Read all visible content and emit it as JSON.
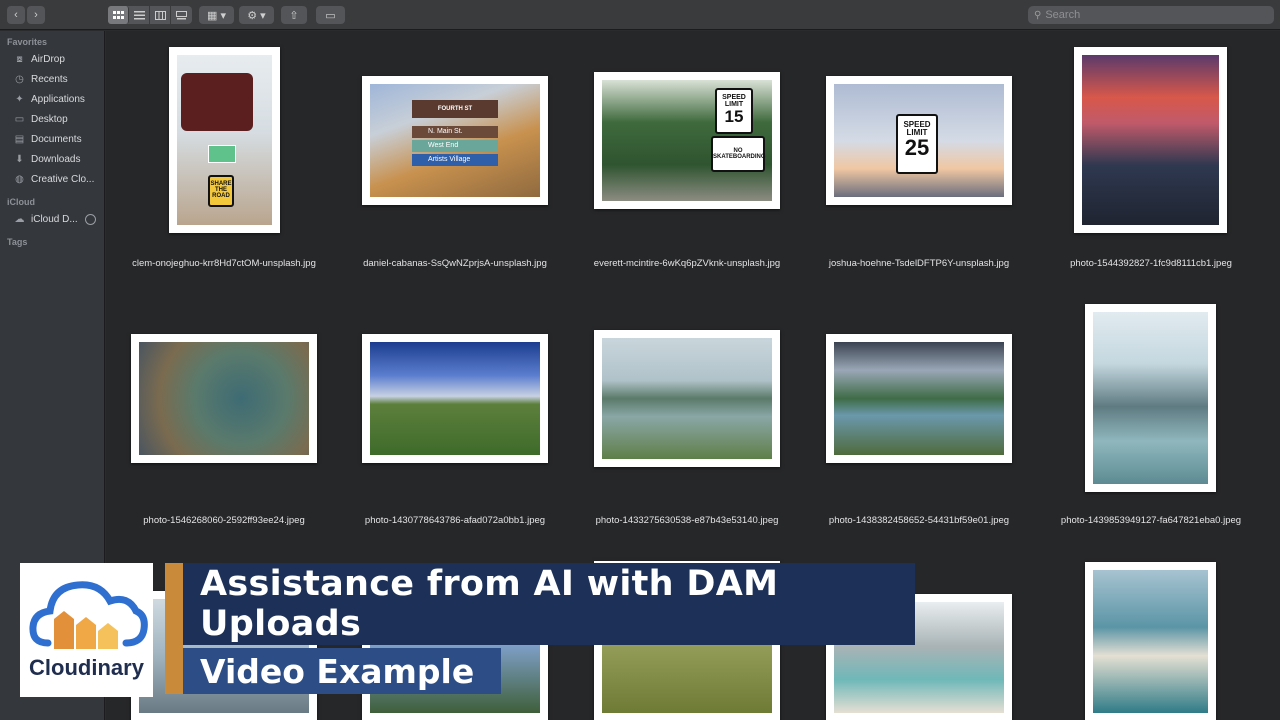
{
  "search": {
    "placeholder": "Search"
  },
  "sidebar": {
    "favorites_header": "Favorites",
    "icloud_header": "iCloud",
    "tags_header": "Tags",
    "favorites": [
      {
        "label": "AirDrop",
        "icon": "airdrop-icon"
      },
      {
        "label": "Recents",
        "icon": "clock-icon"
      },
      {
        "label": "Applications",
        "icon": "applications-icon"
      },
      {
        "label": "Desktop",
        "icon": "desktop-icon"
      },
      {
        "label": "Documents",
        "icon": "document-icon"
      },
      {
        "label": "Downloads",
        "icon": "download-icon"
      },
      {
        "label": "Creative Clo...",
        "icon": "creative-cloud-icon"
      }
    ],
    "icloud": [
      {
        "label": "iCloud D...",
        "icon": "cloud-icon"
      }
    ]
  },
  "files": [
    "clem-onojeghuo-krr8Hd7ctOM-unsplash.jpg",
    "daniel-cabanas-SsQwNZprjsA-unsplash.jpg",
    "everett-mcintire-6wKq6pZVknk-unsplash.jpg",
    "joshua-hoehne-TsdelDFTP6Y-unsplash.jpg",
    "photo-1544392827-1fc9d8111cb1.jpeg",
    "photo-1546268060-2592ff93ee24.jpeg",
    "photo-1430778643786-afad072a0bb1.jpeg",
    "photo-1433275630538-e87b43e53140.jpeg",
    "photo-1438382458652-54431bf59e01.jpeg",
    "photo-1439853949127-fa647821eba0.jpeg"
  ],
  "signs": {
    "street_title": "FOURTH ST",
    "street_1": "N. Main St.",
    "street_2": "West End",
    "street_3": "Artists Village",
    "speed_15_top": "SPEED",
    "speed_15_mid": "LIMIT",
    "speed_15_num": "15",
    "no_skate": "NO SKATEBOARDING",
    "speed_25_top": "SPEED",
    "speed_25_mid": "LIMIT",
    "speed_25_num": "25",
    "share_road": "SHARE THE ROAD"
  },
  "banner": {
    "logo_text": "Cloudinary",
    "title": "Assistance from AI with DAM Uploads",
    "subtitle": "Video Example"
  },
  "colors": {
    "banner_title_bg": "#1d3158",
    "banner_sub_bg": "#2d4d86",
    "accent": "#c98a3a"
  }
}
